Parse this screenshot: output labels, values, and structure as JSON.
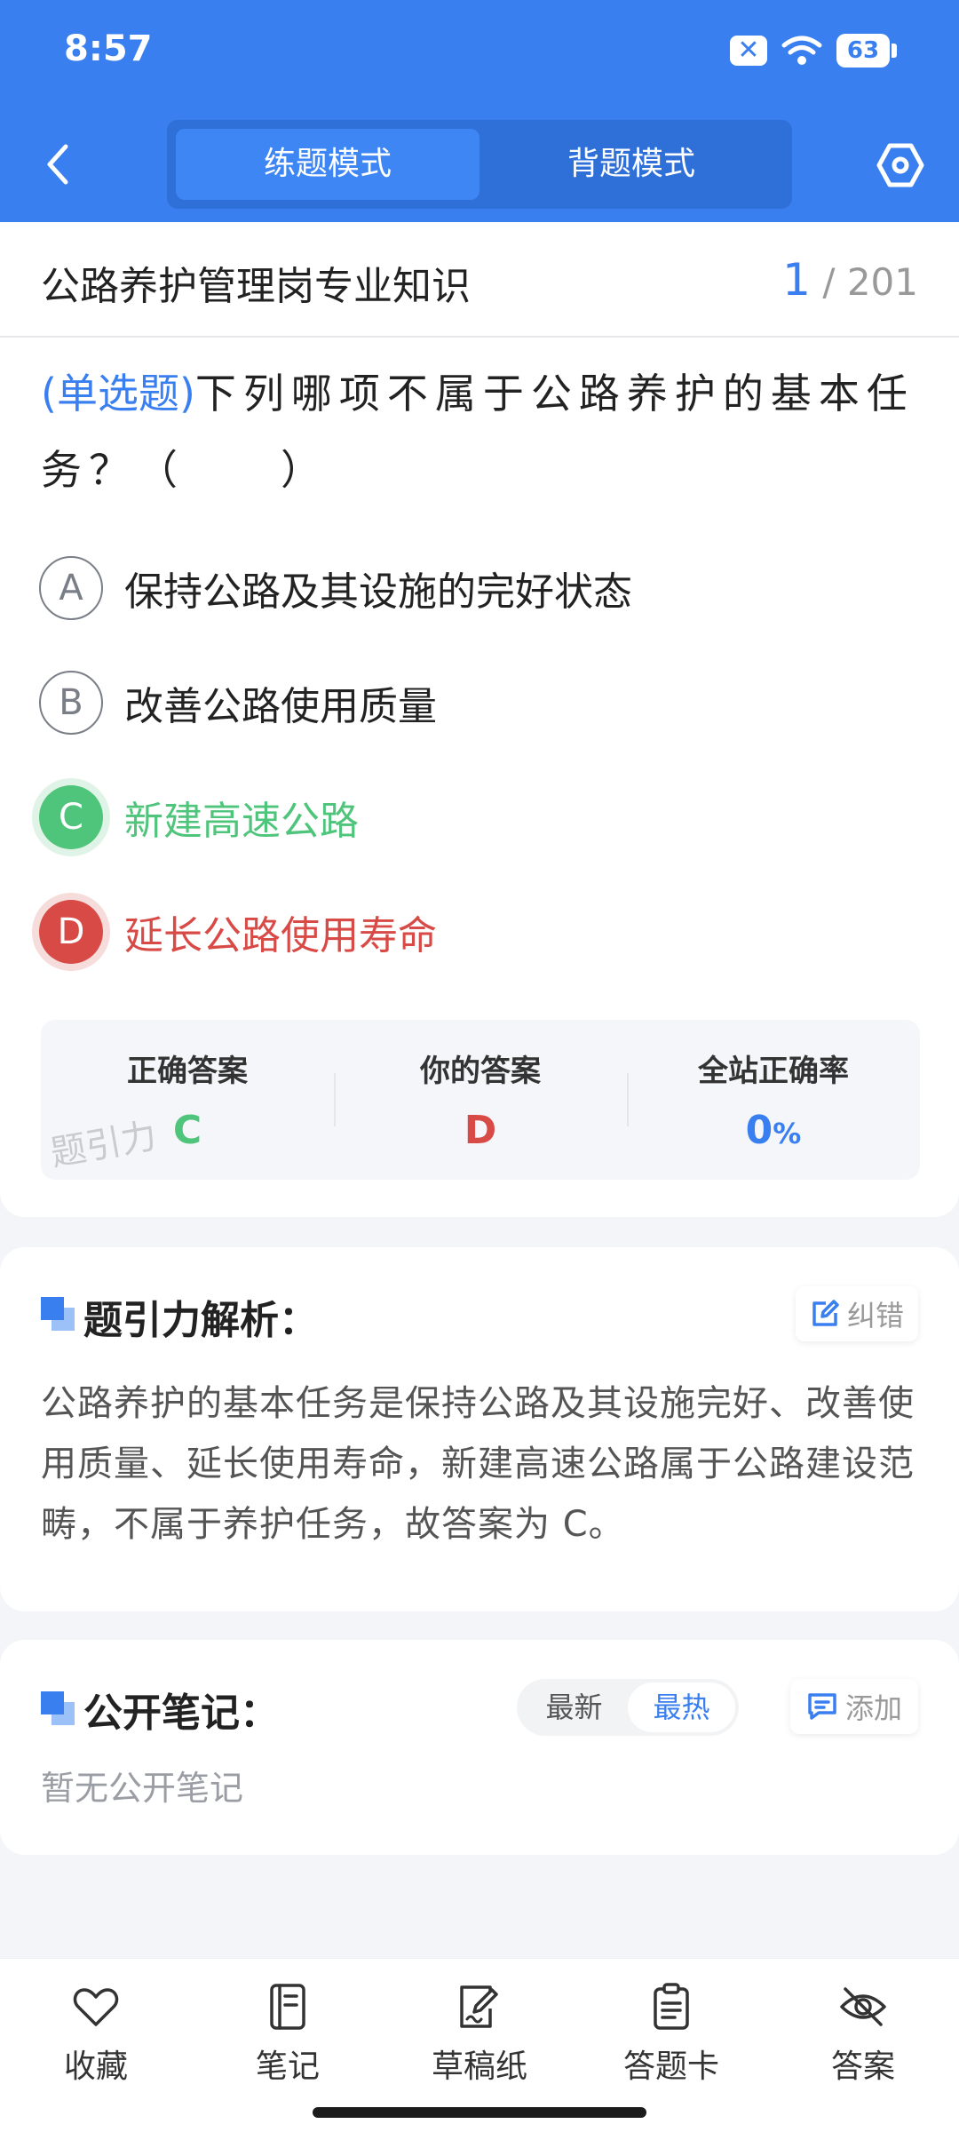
{
  "status_bar": {
    "time": "8:57",
    "battery": "63"
  },
  "header": {
    "mode_tabs": [
      "练题模式",
      "背题模式"
    ]
  },
  "question_card": {
    "subject": "公路养护管理岗专业知识",
    "current": "1",
    "total": "/ 201",
    "question_type": "(单选题)",
    "question_text": "下列哪项不属于公路养护的基本任务？（　　）",
    "options": [
      {
        "letter": "A",
        "text": "保持公路及其设施的完好状态",
        "state": "normal"
      },
      {
        "letter": "B",
        "text": "改善公路使用质量",
        "state": "normal"
      },
      {
        "letter": "C",
        "text": "新建高速公路",
        "state": "correct"
      },
      {
        "letter": "D",
        "text": "延长公路使用寿命",
        "state": "wrong"
      }
    ],
    "answer_panel": {
      "correct_label": "正确答案",
      "correct_value": "C",
      "yours_label": "你的答案",
      "yours_value": "D",
      "rate_label": "全站正确率",
      "rate_value": "0",
      "rate_unit": "%",
      "watermark": "题引力"
    }
  },
  "analysis": {
    "title": "题引力解析：",
    "correct_button": "纠错",
    "text": "公路养护的基本任务是保持公路及其设施完好、改善使用质量、延长使用寿命，新建高速公路属于公路建设范畴，不属于养护任务，故答案为 C。"
  },
  "notes": {
    "title": "公开笔记：",
    "sort_options": [
      "最新",
      "最热"
    ],
    "add_button": "添加",
    "empty_text": "暂无公开笔记"
  },
  "bottom_tabs": [
    {
      "label": "收藏",
      "icon": "heart-icon"
    },
    {
      "label": "笔记",
      "icon": "notebook-icon"
    },
    {
      "label": "草稿纸",
      "icon": "draft-paper-icon"
    },
    {
      "label": "答题卡",
      "icon": "answer-sheet-icon"
    },
    {
      "label": "答案",
      "icon": "eye-off-icon"
    }
  ],
  "colors": {
    "primary": "#3a7ff0",
    "correct": "#4fc47b",
    "wrong": "#d84a46"
  }
}
